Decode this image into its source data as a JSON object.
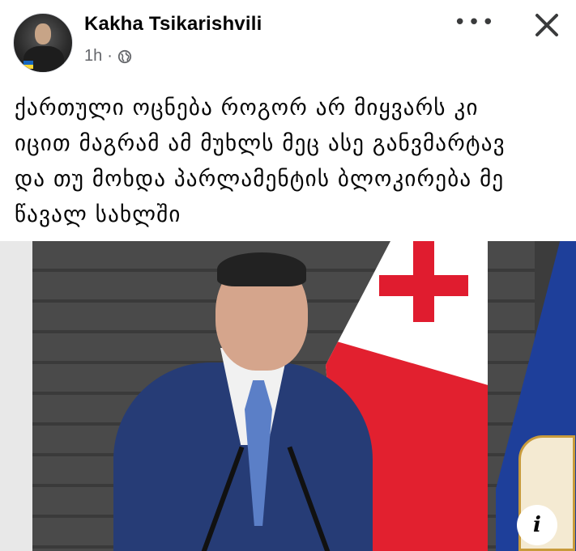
{
  "post": {
    "author": "Kakha Tsikarishvili",
    "time": "1h",
    "separator": "·",
    "privacy_icon": "globe-icon",
    "text_lines": [
      "ქართული ოცნება როგორ არ მიყვარს კი",
      "იცით მაგრამ ამ მუხლს მეც ასე განვმარტავ",
      "და თუ მოხდა პარლამენტის ბლოკირება მე",
      "წავალ სახლში"
    ]
  },
  "controls": {
    "more_label": "•••",
    "more_icon": "more-options-icon",
    "close_icon": "close-icon",
    "info_label": "i",
    "info_icon": "info-icon"
  },
  "colors": {
    "text": "#050505",
    "meta": "#65676b",
    "flag_red": "#e01c2f"
  }
}
